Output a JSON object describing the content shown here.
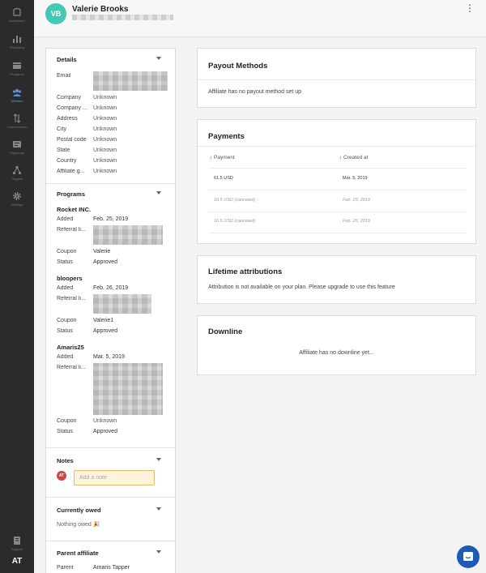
{
  "sidebar": {
    "items": [
      {
        "label": "Dashboard",
        "icon": "dashboard-icon"
      },
      {
        "label": "Reporting",
        "icon": "bar-chart-icon"
      },
      {
        "label": "Programs",
        "icon": "programs-icon"
      },
      {
        "label": "Affiliates",
        "icon": "affiliates-icon"
      },
      {
        "label": "Commissions",
        "icon": "commissions-icon"
      },
      {
        "label": "Payments",
        "icon": "payments-icon"
      },
      {
        "label": "Triggers",
        "icon": "triggers-icon"
      },
      {
        "label": "Settings",
        "icon": "gear-icon"
      }
    ],
    "support_label": "Support",
    "user_initials": "AT"
  },
  "header": {
    "avatar_initials": "VB",
    "name": "Valerie Brooks"
  },
  "details": {
    "title": "Details",
    "rows": [
      {
        "label": "Email",
        "value": ""
      },
      {
        "label": "Company",
        "value": "Unknown"
      },
      {
        "label": "Company ...",
        "value": "Unknown"
      },
      {
        "label": "Address",
        "value": "Unknown"
      },
      {
        "label": "City",
        "value": "Unknown"
      },
      {
        "label": "Postal code",
        "value": "Unknown"
      },
      {
        "label": "State",
        "value": "Unknown"
      },
      {
        "label": "Country",
        "value": "Unknown"
      },
      {
        "label": "Affiliate g...",
        "value": "Unknown"
      }
    ]
  },
  "programs": {
    "title": "Programs",
    "items": [
      {
        "name": "Rocket INC.",
        "added_label": "Added",
        "added": "Feb. 25, 2019",
        "referral_label": "Referral li...",
        "coupon_label": "Coupon",
        "coupon": "Valerie",
        "status_label": "Status",
        "status": "Approved"
      },
      {
        "name": "bloopers",
        "added_label": "Added",
        "added": "Feb. 26, 2019",
        "referral_label": "Referral li...",
        "coupon_label": "Coupon",
        "coupon": "Valerie1",
        "status_label": "Status",
        "status": "Approved"
      },
      {
        "name": "Amaris25",
        "added_label": "Added",
        "added": "Mar. 5, 2019",
        "referral_label": "Referral li...",
        "coupon_label": "Coupon",
        "coupon": "Unknown",
        "status_label": "Status",
        "status": "Approved"
      }
    ]
  },
  "notes": {
    "title": "Notes",
    "author_initials": "AT",
    "placeholder": "Add a note"
  },
  "owed": {
    "title": "Currently owed",
    "text": "Nothing owed 🎉"
  },
  "parent": {
    "title": "Parent affiliate",
    "label": "Parent",
    "value": "Amaris Tapper"
  },
  "payout": {
    "title": "Payout Methods",
    "text": "Affiliate has no payout method set up"
  },
  "payments": {
    "title": "Payments",
    "col_payment": "↕ Payment",
    "col_created": "↕ Created at",
    "rows": [
      {
        "amount": "61.5 USD",
        "date": "Mar. 5, 2019",
        "canceled": false
      },
      {
        "amount": "16.5 USD (canceled)",
        "date": "Feb. 25, 2019",
        "canceled": true
      },
      {
        "amount": "16.5 USD (canceled)",
        "date": "Feb. 25, 2019",
        "canceled": true
      }
    ]
  },
  "lifetime": {
    "title": "Lifetime attributions",
    "text": "Attribution is not available on your plan. Please upgrade to use this feature"
  },
  "downline": {
    "title": "Downline",
    "text": "Affiliate has no downline yet..."
  },
  "colors": {
    "sidebar_bg": "#2b2b2b",
    "avatar": "#45c7b3",
    "active_nav": "#5b8fd8",
    "note_input_bg": "#fff3dc",
    "chat_button": "#1f5bb5"
  }
}
